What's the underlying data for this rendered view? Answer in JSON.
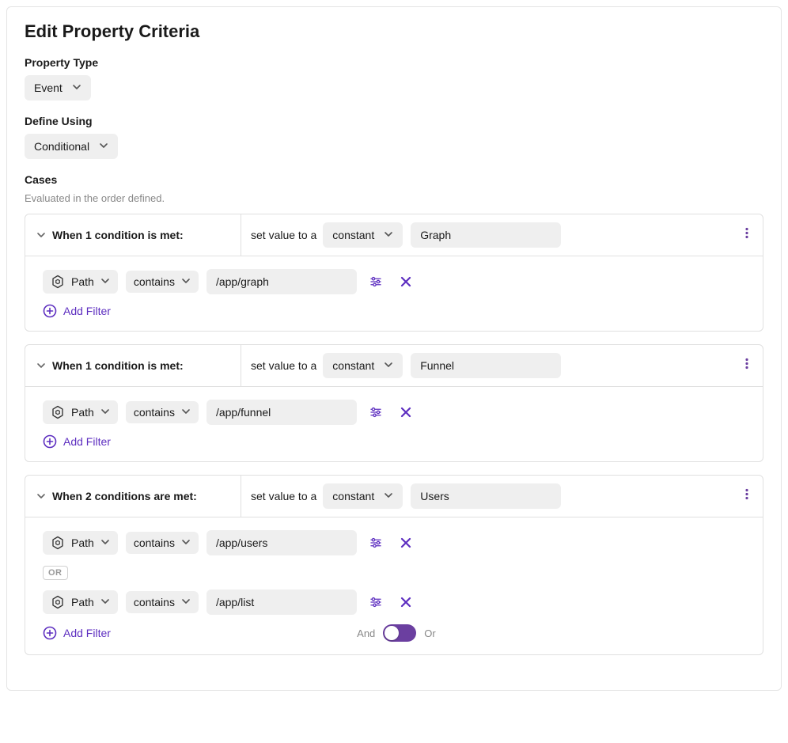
{
  "title": "Edit Property Criteria",
  "propertyTypeLabel": "Property Type",
  "propertyTypeValue": "Event",
  "defineUsingLabel": "Define Using",
  "defineUsingValue": "Conditional",
  "casesLabel": "Cases",
  "casesSub": "Evaluated in the order defined.",
  "setValuePrefix": "set value to a",
  "constantLabel": "constant",
  "addFilterLabel": "Add Filter",
  "andLabel": "And",
  "orLabel": "Or",
  "orBadge": "OR",
  "cases": [
    {
      "whenLabel": "When 1 condition is met:",
      "valueType": "constant",
      "valueText": "Graph",
      "filters": [
        {
          "field": "Path",
          "op": "contains",
          "value": "/app/graph"
        }
      ],
      "showAndOr": false
    },
    {
      "whenLabel": "When 1 condition is met:",
      "valueType": "constant",
      "valueText": "Funnel",
      "filters": [
        {
          "field": "Path",
          "op": "contains",
          "value": "/app/funnel"
        }
      ],
      "showAndOr": false
    },
    {
      "whenLabel": "When 2 conditions are met:",
      "valueType": "constant",
      "valueText": "Users",
      "filters": [
        {
          "field": "Path",
          "op": "contains",
          "value": "/app/users"
        },
        {
          "field": "Path",
          "op": "contains",
          "value": "/app/list"
        }
      ],
      "join": "OR",
      "showAndOr": true
    }
  ]
}
